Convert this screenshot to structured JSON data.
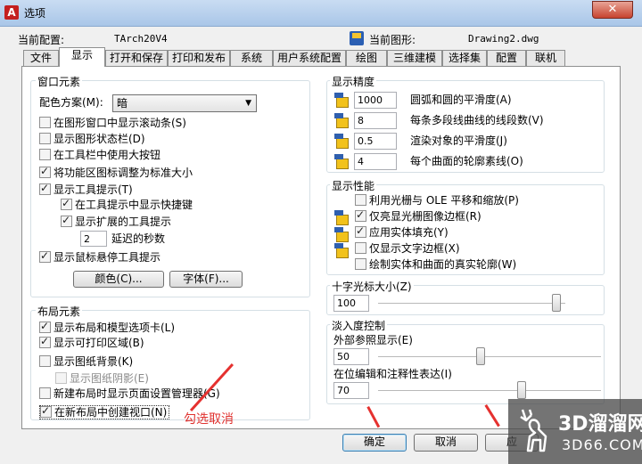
{
  "window": {
    "title": "选项",
    "close": "✕"
  },
  "config": {
    "current_profile_label": "当前配置:",
    "current_profile_value": "TArch20V4",
    "current_drawing_label": "当前图形:",
    "current_drawing_value": "Drawing2.dwg"
  },
  "tabs": [
    "文件",
    "显示",
    "打开和保存",
    "打印和发布",
    "系统",
    "用户系统配置",
    "绘图",
    "三维建模",
    "选择集",
    "配置",
    "联机"
  ],
  "window_elements": {
    "title": "窗口元素",
    "color_scheme_label": "配色方案(M):",
    "color_scheme_value": "暗",
    "items": [
      {
        "label": "在图形窗口中显示滚动条(S)",
        "checked": false
      },
      {
        "label": "显示图形状态栏(D)",
        "checked": false
      },
      {
        "label": "在工具栏中使用大按钮",
        "checked": false
      },
      {
        "label": "将功能区图标调整为标准大小",
        "checked": true
      },
      {
        "label": "显示工具提示(T)",
        "checked": true
      },
      {
        "label": "在工具提示中显示快捷键",
        "checked": true
      },
      {
        "label": "显示扩展的工具提示",
        "checked": true
      },
      {
        "label": "显示鼠标悬停工具提示",
        "checked": true
      }
    ],
    "delay_value": "2",
    "delay_label": "延迟的秒数",
    "colors_button": "颜色(C)...",
    "fonts_button": "字体(F)..."
  },
  "layout_elements": {
    "title": "布局元素",
    "items": [
      {
        "label": "显示布局和模型选项卡(L)",
        "checked": true
      },
      {
        "label": "显示可打印区域(B)",
        "checked": true
      },
      {
        "label": "显示图纸背景(K)",
        "checked": false
      },
      {
        "label": "显示图纸阴影(E)",
        "checked": false
      },
      {
        "label": "新建布局时显示页面设置管理器(G)",
        "checked": false
      },
      {
        "label": "在新布局中创建视口(N)",
        "checked": true
      }
    ]
  },
  "display_resolution": {
    "title": "显示精度",
    "items": [
      {
        "value": "1000",
        "label": "圆弧和圆的平滑度(A)"
      },
      {
        "value": "8",
        "label": "每条多段线曲线的线段数(V)"
      },
      {
        "value": "0.5",
        "label": "渲染对象的平滑度(J)"
      },
      {
        "value": "4",
        "label": "每个曲面的轮廓素线(O)"
      }
    ]
  },
  "display_performance": {
    "title": "显示性能",
    "items": [
      {
        "label": "利用光栅与 OLE 平移和缩放(P)",
        "checked": false
      },
      {
        "label": "仅亮显光栅图像边框(R)",
        "checked": true
      },
      {
        "label": "应用实体填充(Y)",
        "checked": true
      },
      {
        "label": "仅显示文字边框(X)",
        "checked": false
      },
      {
        "label": "绘制实体和曲面的真实轮廓(W)",
        "checked": false
      }
    ]
  },
  "crosshair": {
    "title": "十字光标大小(Z)",
    "value": "100",
    "level": 100
  },
  "fade_control": {
    "title": "淡入度控制",
    "xref_label": "外部参照显示(E)",
    "xref_value": "50",
    "xref_level": 50,
    "inplace_label": "在位编辑和注释性表达(I)",
    "inplace_value": "70",
    "inplace_level": 70
  },
  "buttons": {
    "ok": "确定",
    "cancel": "取消",
    "apply": "应"
  },
  "annotation": {
    "text": "勾选取消"
  },
  "watermark": {
    "brand": "3D溜溜网",
    "url": "3D66.COM"
  }
}
